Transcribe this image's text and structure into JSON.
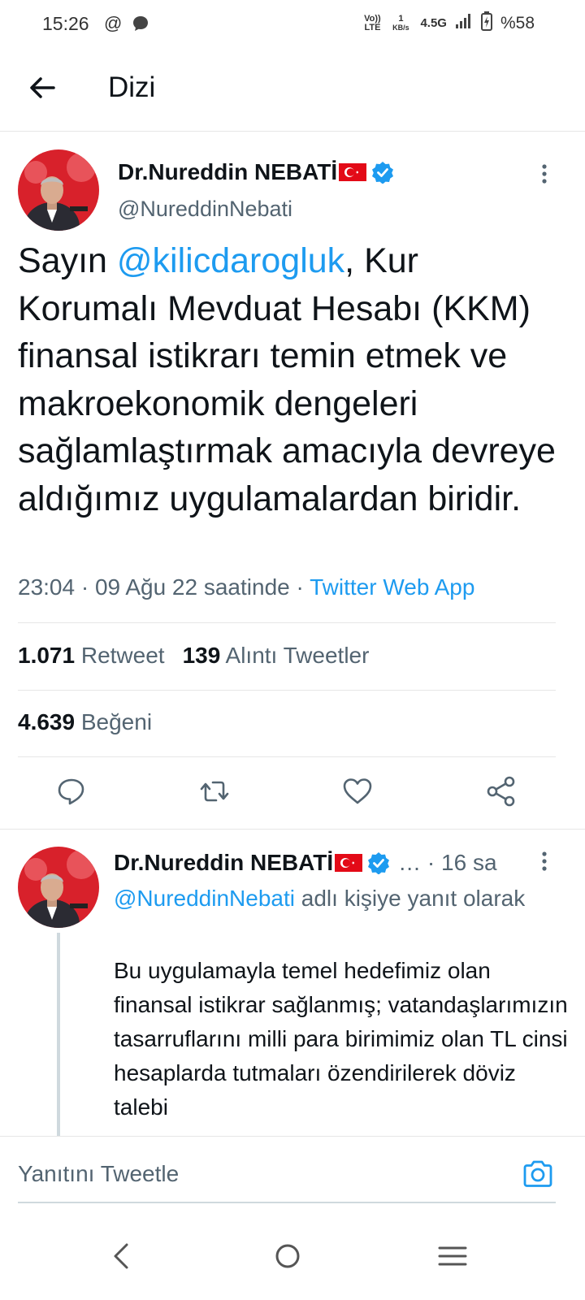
{
  "status_bar": {
    "time": "15:26",
    "icons": [
      "at-icon",
      "chat-bubble-icon"
    ],
    "volte": "Vo)) LTE",
    "speed_value": "1",
    "speed_unit": "KB/s",
    "network": "4.5G",
    "battery": "%58"
  },
  "header": {
    "title": "Dizi"
  },
  "main_tweet": {
    "author": "Dr.Nureddin NEBATİ",
    "handle": "@NureddinNebati",
    "text_prefix": "Sayın ",
    "mention": "@kilicdarogluk",
    "text_body": ", Kur Korumalı Mevduat Hesabı (KKM) finansal istikrarı temin etmek ve makroekonomik dengeleri sağlamlaştırmak amacıyla devreye aldığımız uygulamalardan biridir.",
    "meta_time": "23:04 · 09 Ağu 22 saatinde · ",
    "source": "Twitter Web App",
    "retweets_count": "1.071",
    "retweets_label": "Retweet",
    "quotes_count": "139",
    "quotes_label": "Alıntı Tweetler",
    "likes_count": "4.639",
    "likes_label": "Beğeni"
  },
  "reply_tweet": {
    "author": "Dr.Nureddin NEBATİ",
    "ellipsis": "…",
    "time": " · 16 sa",
    "reply_to_handle": "@NureddinNebati",
    "reply_to_suffix": " adlı kişiye yanıt olarak",
    "text": "Bu uygulamayla temel hedefimiz olan finansal istikrar sağlanmış; vatandaşlarımızın tasarruflarını milli para birimimiz olan TL cinsi hesaplarda tutmaları özendirilerek döviz talebi"
  },
  "compose": {
    "placeholder": "Yanıtını Tweetle"
  },
  "colors": {
    "accent": "#1d9bf0",
    "secondary_text": "#536471",
    "primary_text": "#0f1419",
    "divider": "#e6e6e6"
  }
}
